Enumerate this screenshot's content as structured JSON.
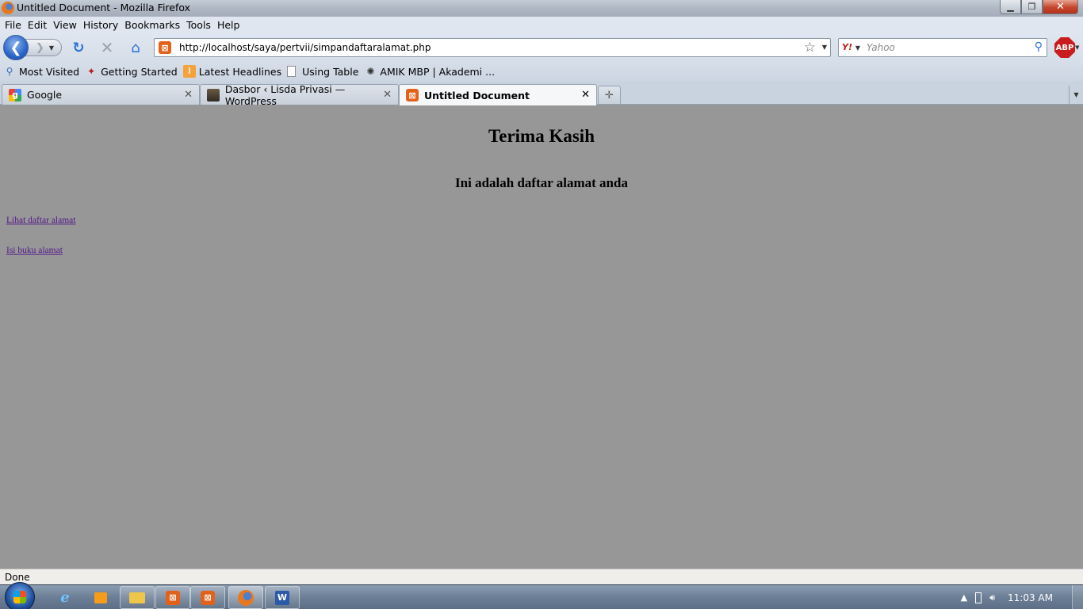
{
  "window": {
    "title": "Untitled Document - Mozilla Firefox",
    "buttons": {
      "minimize": "▁",
      "maximize": "❐",
      "close": "✕"
    }
  },
  "menu": [
    "File",
    "Edit",
    "View",
    "History",
    "Bookmarks",
    "Tools",
    "Help"
  ],
  "nav": {
    "url": "http://localhost/saya/pertvii/simpandaftaralamat.php",
    "search_placeholder": "Yahoo",
    "search_engine": "Y!",
    "abp_label": "ABP"
  },
  "bookmarks": [
    {
      "label": "Most Visited",
      "icon": "most-visited-icon"
    },
    {
      "label": "Getting Started",
      "icon": "getting-started-icon"
    },
    {
      "label": "Latest Headlines",
      "icon": "rss-icon"
    },
    {
      "label": "Using Table",
      "icon": "page-icon"
    },
    {
      "label": "AMIK MBP | Akademi ...",
      "icon": "amik-icon"
    }
  ],
  "tabs": [
    {
      "label": "Google",
      "icon": "google-icon",
      "active": false
    },
    {
      "label": "Dasbor ‹ Lisda Privasi — WordPress",
      "icon": "wordpress-icon",
      "active": false
    },
    {
      "label": "Untitled Document",
      "icon": "xampp-icon",
      "active": true
    }
  ],
  "page": {
    "heading": "Terima Kasih",
    "subheading": "Ini adalah daftar alamat anda",
    "links": [
      "Lihat daftar alamat",
      "Isi buku alamat"
    ],
    "background": "#979797",
    "link_color": "#551a8b"
  },
  "status": "Done",
  "taskbar": {
    "clock": "11:03 AM"
  }
}
